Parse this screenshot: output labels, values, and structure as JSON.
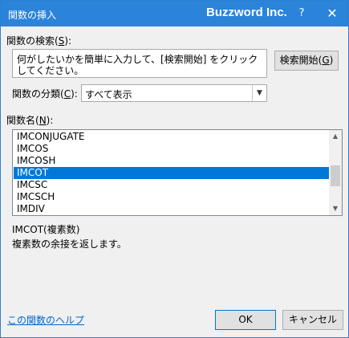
{
  "window": {
    "title": "関数の挿入",
    "brand": "Buzzword Inc.",
    "help_glyph": "?",
    "close_glyph": "✕"
  },
  "search": {
    "label_text": "関数の検索(",
    "label_key": "S",
    "label_suffix": "):",
    "value": "何がしたいかを簡単に入力して、[検索開始] をクリックしてください。",
    "button_text": "検索開始(",
    "button_key": "G",
    "button_suffix": ")"
  },
  "category": {
    "label_text": "関数の分類(",
    "label_key": "C",
    "label_suffix": "):",
    "selected": "すべて表示"
  },
  "function_list": {
    "label_text": "関数名(",
    "label_key": "N",
    "label_suffix": "):",
    "items": [
      "IMCONJUGATE",
      "IMCOS",
      "IMCOSH",
      "IMCOT",
      "IMCSC",
      "IMCSCH",
      "IMDIV"
    ],
    "selected_index": 3
  },
  "description": {
    "signature": "IMCOT(複素数)",
    "text": "複素数の余接を返します。"
  },
  "footer": {
    "help_link": "この関数のヘルプ",
    "ok": "OK",
    "cancel": "キャンセル"
  }
}
